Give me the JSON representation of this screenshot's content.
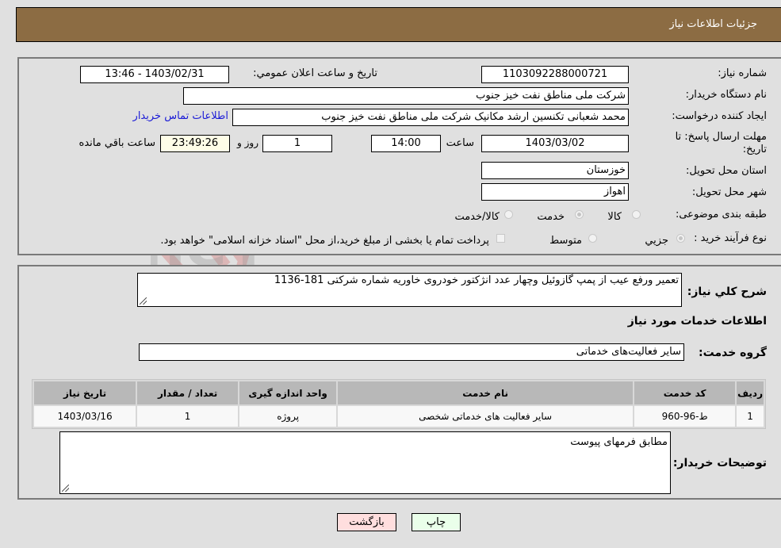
{
  "header": {
    "title": "جزئیات اطلاعات نیاز"
  },
  "form": {
    "need_number": {
      "label": "شماره نیاز:",
      "value": "1103092288000721"
    },
    "announce_datetime": {
      "label": "تاریخ و ساعت اعلان عمومي:",
      "value": "1403/02/31 - 13:46"
    },
    "buyer_org": {
      "label": "نام دستگاه خریدار:",
      "value": "شرکت ملی مناطق نفت خیز جنوب"
    },
    "requester": {
      "label": "ایجاد کننده درخواست:",
      "value": "محمد شعبانی تکنسین ارشد مکانیک شرکت ملی مناطق نفت خیز جنوب",
      "contact_link": "اطلاعات تماس خریدار"
    },
    "deadline": {
      "label_line1": "مهلت ارسال پاسخ: تا",
      "label_line2": "تاریخ:",
      "date": "1403/03/02",
      "time_label": "ساعت",
      "time": "14:00",
      "days": "1",
      "days_label": "روز و",
      "remaining": "23:49:26",
      "remaining_label": "ساعت باقي مانده"
    },
    "province": {
      "label": "استان محل تحویل:",
      "value": "خوزستان"
    },
    "city": {
      "label": "شهر محل تحویل:",
      "value": "اهواز"
    },
    "category": {
      "label": "طبقه بندی موضوعی:",
      "options": [
        "کالا",
        "خدمت",
        "کالا/خدمت"
      ],
      "selected": "خدمت"
    },
    "purchase_type": {
      "label": "نوع فرآیند خرید :",
      "options": [
        "جزيي",
        "متوسط"
      ],
      "selected": "جزيي",
      "treasury_checkbox_label": "پرداخت تمام یا بخشی از مبلغ خرید،از محل \"اسناد خزانه اسلامی\" خواهد بود.",
      "treasury_checked": false
    }
  },
  "details": {
    "general_desc_label": "شرح کلي نیاز:",
    "general_desc": "تعمیر ورفع عیب از پمپ گازوئیل وچهار عدد انژکتور خودروی خاوریه شماره شرکتی 181-1136",
    "services_heading": "اطلاعات خدمات مورد نیاز",
    "service_group_label": "گروه خدمت:",
    "service_group": "سایر فعالیت‌های خدماتی",
    "table": {
      "headers": [
        "ردیف",
        "کد خدمت",
        "نام خدمت",
        "واحد اندازه گیری",
        "تعداد / مقدار",
        "تاریخ نیاز"
      ],
      "rows": [
        [
          "1",
          "ط-96-960",
          "سایر فعالیت های خدماتی شخصی",
          "پروژه",
          "1",
          "1403/03/16"
        ]
      ]
    },
    "buyer_notes_label": "توضیحات خریدار:",
    "buyer_notes": "مطابق فرمهای پیوست"
  },
  "buttons": {
    "print": "چاپ",
    "back": "بازگشت"
  },
  "watermark": {
    "text": "AriaTender.neT"
  },
  "colors": {
    "header_bg": "#8c6c43",
    "print_bg": "#eaffea",
    "back_bg": "#ffdede",
    "link": "#1a1ad6"
  }
}
